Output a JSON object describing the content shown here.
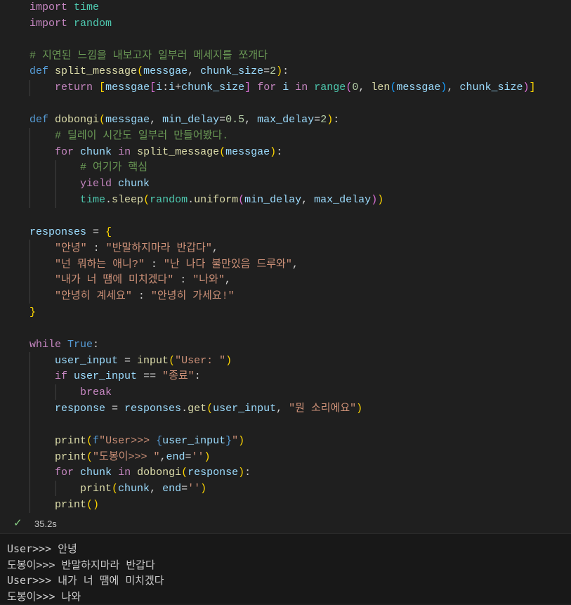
{
  "code_lines": [
    [
      {
        "t": "import",
        "c": "ctl"
      },
      {
        "t": " "
      },
      {
        "t": "time",
        "c": "mod"
      }
    ],
    [
      {
        "t": "import",
        "c": "ctl"
      },
      {
        "t": " "
      },
      {
        "t": "random",
        "c": "mod"
      }
    ],
    [],
    [
      {
        "t": "# 지연된 느낌을 내보고자 일부러 메세지를 쪼개다",
        "c": "cmt"
      }
    ],
    [
      {
        "t": "def",
        "c": "kw"
      },
      {
        "t": " "
      },
      {
        "t": "split_message",
        "c": "fn"
      },
      {
        "t": "(",
        "c": "br1"
      },
      {
        "t": "messgae",
        "c": "var"
      },
      {
        "t": ", "
      },
      {
        "t": "chunk_size",
        "c": "var"
      },
      {
        "t": "="
      },
      {
        "t": "2",
        "c": "num"
      },
      {
        "t": ")",
        "c": "br1"
      },
      {
        "t": ":"
      }
    ],
    [
      {
        "t": "    "
      },
      {
        "t": "return",
        "c": "ctl"
      },
      {
        "t": " "
      },
      {
        "t": "[",
        "c": "br1"
      },
      {
        "t": "messgae",
        "c": "var"
      },
      {
        "t": "[",
        "c": "br2"
      },
      {
        "t": "i",
        "c": "var"
      },
      {
        "t": ":"
      },
      {
        "t": "i",
        "c": "var"
      },
      {
        "t": "+"
      },
      {
        "t": "chunk_size",
        "c": "var"
      },
      {
        "t": "]",
        "c": "br2"
      },
      {
        "t": " "
      },
      {
        "t": "for",
        "c": "ctl"
      },
      {
        "t": " "
      },
      {
        "t": "i",
        "c": "var"
      },
      {
        "t": " "
      },
      {
        "t": "in",
        "c": "ctl"
      },
      {
        "t": " "
      },
      {
        "t": "range",
        "c": "mod"
      },
      {
        "t": "(",
        "c": "br2"
      },
      {
        "t": "0",
        "c": "num"
      },
      {
        "t": ", "
      },
      {
        "t": "len",
        "c": "fn"
      },
      {
        "t": "(",
        "c": "br3"
      },
      {
        "t": "messgae",
        "c": "var"
      },
      {
        "t": ")",
        "c": "br3"
      },
      {
        "t": ", "
      },
      {
        "t": "chunk_size",
        "c": "var"
      },
      {
        "t": ")",
        "c": "br2"
      },
      {
        "t": "]",
        "c": "br1"
      }
    ],
    [],
    [
      {
        "t": "def",
        "c": "kw"
      },
      {
        "t": " "
      },
      {
        "t": "dobongi",
        "c": "fn"
      },
      {
        "t": "(",
        "c": "br1"
      },
      {
        "t": "messgae",
        "c": "var"
      },
      {
        "t": ", "
      },
      {
        "t": "min_delay",
        "c": "var"
      },
      {
        "t": "="
      },
      {
        "t": "0.5",
        "c": "num"
      },
      {
        "t": ", "
      },
      {
        "t": "max_delay",
        "c": "var"
      },
      {
        "t": "="
      },
      {
        "t": "2",
        "c": "num"
      },
      {
        "t": ")",
        "c": "br1"
      },
      {
        "t": ":"
      }
    ],
    [
      {
        "t": "    "
      },
      {
        "t": "# 딜레이 시간도 일부러 만들어봤다.",
        "c": "cmt"
      }
    ],
    [
      {
        "t": "    "
      },
      {
        "t": "for",
        "c": "ctl"
      },
      {
        "t": " "
      },
      {
        "t": "chunk",
        "c": "var"
      },
      {
        "t": " "
      },
      {
        "t": "in",
        "c": "ctl"
      },
      {
        "t": " "
      },
      {
        "t": "split_message",
        "c": "fn"
      },
      {
        "t": "(",
        "c": "br1"
      },
      {
        "t": "messgae",
        "c": "var"
      },
      {
        "t": ")",
        "c": "br1"
      },
      {
        "t": ":"
      }
    ],
    [
      {
        "t": "        "
      },
      {
        "t": "# 여기가 핵심",
        "c": "cmt"
      }
    ],
    [
      {
        "t": "        "
      },
      {
        "t": "yield",
        "c": "ctl"
      },
      {
        "t": " "
      },
      {
        "t": "chunk",
        "c": "var"
      }
    ],
    [
      {
        "t": "        "
      },
      {
        "t": "time",
        "c": "mod"
      },
      {
        "t": "."
      },
      {
        "t": "sleep",
        "c": "fn"
      },
      {
        "t": "(",
        "c": "br1"
      },
      {
        "t": "random",
        "c": "mod"
      },
      {
        "t": "."
      },
      {
        "t": "uniform",
        "c": "fn"
      },
      {
        "t": "(",
        "c": "br2"
      },
      {
        "t": "min_delay",
        "c": "var"
      },
      {
        "t": ", "
      },
      {
        "t": "max_delay",
        "c": "var"
      },
      {
        "t": ")",
        "c": "br2"
      },
      {
        "t": ")",
        "c": "br1"
      }
    ],
    [],
    [
      {
        "t": "responses",
        "c": "var"
      },
      {
        "t": " = "
      },
      {
        "t": "{",
        "c": "br1"
      }
    ],
    [
      {
        "t": "    "
      },
      {
        "t": "\"안녕\"",
        "c": "str"
      },
      {
        "t": " : "
      },
      {
        "t": "\"반말하지마라 반갑다\"",
        "c": "str"
      },
      {
        "t": ","
      }
    ],
    [
      {
        "t": "    "
      },
      {
        "t": "\"넌 뭐하는 애니?\"",
        "c": "str"
      },
      {
        "t": " : "
      },
      {
        "t": "\"난 나다 불만있음 드루와\"",
        "c": "str"
      },
      {
        "t": ","
      }
    ],
    [
      {
        "t": "    "
      },
      {
        "t": "\"내가 너 땜에 미치겠다\"",
        "c": "str"
      },
      {
        "t": " : "
      },
      {
        "t": "\"나와\"",
        "c": "str"
      },
      {
        "t": ","
      }
    ],
    [
      {
        "t": "    "
      },
      {
        "t": "\"안녕히 계세요\"",
        "c": "str"
      },
      {
        "t": " : "
      },
      {
        "t": "\"안녕히 가세요!\"",
        "c": "str"
      }
    ],
    [
      {
        "t": "}",
        "c": "br1"
      }
    ],
    [],
    [
      {
        "t": "while",
        "c": "ctl"
      },
      {
        "t": " "
      },
      {
        "t": "True",
        "c": "kw"
      },
      {
        "t": ":"
      }
    ],
    [
      {
        "t": "    "
      },
      {
        "t": "user_input",
        "c": "var"
      },
      {
        "t": " = "
      },
      {
        "t": "input",
        "c": "fn"
      },
      {
        "t": "(",
        "c": "br1"
      },
      {
        "t": "\"User: \"",
        "c": "str"
      },
      {
        "t": ")",
        "c": "br1"
      }
    ],
    [
      {
        "t": "    "
      },
      {
        "t": "if",
        "c": "ctl"
      },
      {
        "t": " "
      },
      {
        "t": "user_input",
        "c": "var"
      },
      {
        "t": " == "
      },
      {
        "t": "\"종료\"",
        "c": "str"
      },
      {
        "t": ":"
      }
    ],
    [
      {
        "t": "        "
      },
      {
        "t": "break",
        "c": "ctl"
      }
    ],
    [
      {
        "t": "    "
      },
      {
        "t": "response",
        "c": "var"
      },
      {
        "t": " = "
      },
      {
        "t": "responses",
        "c": "var"
      },
      {
        "t": "."
      },
      {
        "t": "get",
        "c": "fn"
      },
      {
        "t": "(",
        "c": "br1"
      },
      {
        "t": "user_input",
        "c": "var"
      },
      {
        "t": ", "
      },
      {
        "t": "\"뭔 소리에요\"",
        "c": "str"
      },
      {
        "t": ")",
        "c": "br1"
      }
    ],
    [],
    [
      {
        "t": "    "
      },
      {
        "t": "print",
        "c": "fn"
      },
      {
        "t": "(",
        "c": "br1"
      },
      {
        "t": "f",
        "c": "kw"
      },
      {
        "t": "\"User>>> ",
        "c": "str"
      },
      {
        "t": "{",
        "c": "kw"
      },
      {
        "t": "user_input",
        "c": "var"
      },
      {
        "t": "}",
        "c": "kw"
      },
      {
        "t": "\"",
        "c": "str"
      },
      {
        "t": ")",
        "c": "br1"
      }
    ],
    [
      {
        "t": "    "
      },
      {
        "t": "print",
        "c": "fn"
      },
      {
        "t": "(",
        "c": "br1"
      },
      {
        "t": "\"도봉이>>> \"",
        "c": "str"
      },
      {
        "t": ","
      },
      {
        "t": "end",
        "c": "var"
      },
      {
        "t": "="
      },
      {
        "t": "''",
        "c": "str"
      },
      {
        "t": ")",
        "c": "br1"
      }
    ],
    [
      {
        "t": "    "
      },
      {
        "t": "for",
        "c": "ctl"
      },
      {
        "t": " "
      },
      {
        "t": "chunk",
        "c": "var"
      },
      {
        "t": " "
      },
      {
        "t": "in",
        "c": "ctl"
      },
      {
        "t": " "
      },
      {
        "t": "dobongi",
        "c": "fn"
      },
      {
        "t": "(",
        "c": "br1"
      },
      {
        "t": "response",
        "c": "var"
      },
      {
        "t": ")",
        "c": "br1"
      },
      {
        "t": ":"
      }
    ],
    [
      {
        "t": "        "
      },
      {
        "t": "print",
        "c": "fn"
      },
      {
        "t": "(",
        "c": "br1"
      },
      {
        "t": "chunk",
        "c": "var"
      },
      {
        "t": ", "
      },
      {
        "t": "end",
        "c": "var"
      },
      {
        "t": "="
      },
      {
        "t": "''",
        "c": "str"
      },
      {
        "t": ")",
        "c": "br1"
      }
    ],
    [
      {
        "t": "    "
      },
      {
        "t": "print",
        "c": "fn"
      },
      {
        "t": "(",
        "c": "br1"
      },
      {
        "t": ")",
        "c": "br1"
      }
    ]
  ],
  "status": {
    "check_icon": "✓",
    "duration": "35.2s"
  },
  "output_lines": [
    "User>>> 안녕",
    "도봉이>>> 반말하지마라 반갑다",
    "User>>> 내가 너 땜에 미치겠다",
    "도봉이>>> 나와"
  ]
}
